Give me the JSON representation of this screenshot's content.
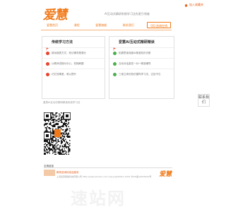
{
  "header": {
    "home_link": "加入收藏夹",
    "logo_text": "爱慧",
    "slogan": "AI互动式精研系统学习法先驱引领者"
  },
  "nav": {
    "items": [
      {
        "label": "爱慧首页"
      },
      {
        "label": "课程"
      },
      {
        "label": "爱慧旗舰"
      },
      {
        "label": "联系我们"
      },
      {
        "label": "QQ:咨询在线"
      }
    ]
  },
  "panels": {
    "left": {
      "title": "传统学习方法",
      "rows": [
        {
          "text": "被动接受方式，死记硬背是源头"
        },
        {
          "text": "以教师讲授为中心，机械刷题"
        },
        {
          "text": "记忆效果差，难以提升"
        }
      ]
    },
    "right": {
      "title": "爱慧AI互动式精研精读",
      "rows": [
        {
          "text": "拓展思维深度AI精准知识诊断"
        },
        {
          "text": "互动对话激发一对一精准辅导"
        },
        {
          "text": "三维立体化知识建构学习法，过目不忘"
        }
      ]
    }
  },
  "sidebar": {
    "label": "联系我们"
  },
  "footnote": "爱慧AI互动式精研精读系统学习法",
  "footer": {
    "friendlinks_label": "友情链接",
    "link_text": "教育咨询热线及服务",
    "copyright": "上海爱慧网络科技有限公司 http://www.aihuixx.com Copyright2011-2015 沪ICP备10025442号",
    "brand_text": "爱慧"
  },
  "watermark": "速站网",
  "colors": {
    "accent": "#f07a1a",
    "red_dot": "#e8432d",
    "green_dot": "#4cae4c"
  },
  "icons": {
    "home": "home-icon",
    "flag": "flag-icon"
  }
}
